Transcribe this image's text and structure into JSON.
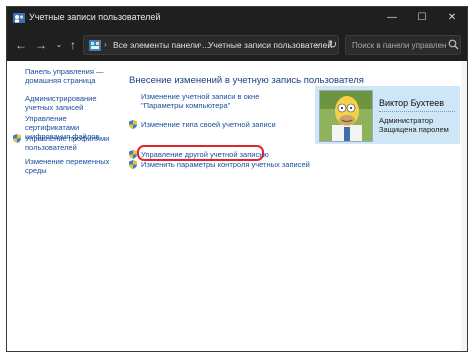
{
  "window": {
    "title": "Учетные записи пользователей",
    "controls": {
      "minimize": "—",
      "maximize": "☐",
      "close": "✕"
    }
  },
  "nav": {
    "back": "←",
    "forward": "→",
    "dropdown": "⌄",
    "up": "↑"
  },
  "address": {
    "crumbs": [
      "Все элементы панели ...",
      "Учетные записи пользователей"
    ],
    "separator": "›",
    "dropdown": "⌄",
    "refresh": "↻"
  },
  "search": {
    "placeholder": "Поиск в панели управления"
  },
  "sidebar": {
    "items": [
      {
        "label": "Панель управления — домашняя страница"
      },
      {
        "label": "Администрирование учетных записей"
      },
      {
        "label": "Управление сертификатами шифрования файлов"
      },
      {
        "label": "Управление профилями пользователей",
        "icon": "shield-icon"
      },
      {
        "label": "Изменение переменных среды"
      }
    ]
  },
  "main": {
    "heading": "Внесение изменений в учетную запись пользователя",
    "tasks": [
      {
        "label": "Изменение учетной записи в окне \"Параметры компьютера\""
      },
      {
        "label": "Изменение типа своей учетной записи",
        "icon": "shield-icon"
      },
      {
        "label": "Управление другой учетной записью",
        "icon": "shield-icon",
        "highlighted": true
      },
      {
        "label": "Изменить параметры контроля учетных записей",
        "icon": "shield-icon"
      }
    ]
  },
  "account": {
    "name": "Виктор Бухтеев",
    "role": "Администратор",
    "password_status": "Защищена паролем"
  },
  "colors": {
    "titlebar": "#1f1f1f",
    "link": "#1a4fa0",
    "heading": "#1e3f86",
    "card": "#cfe6f6",
    "highlight": "#e3262b"
  }
}
